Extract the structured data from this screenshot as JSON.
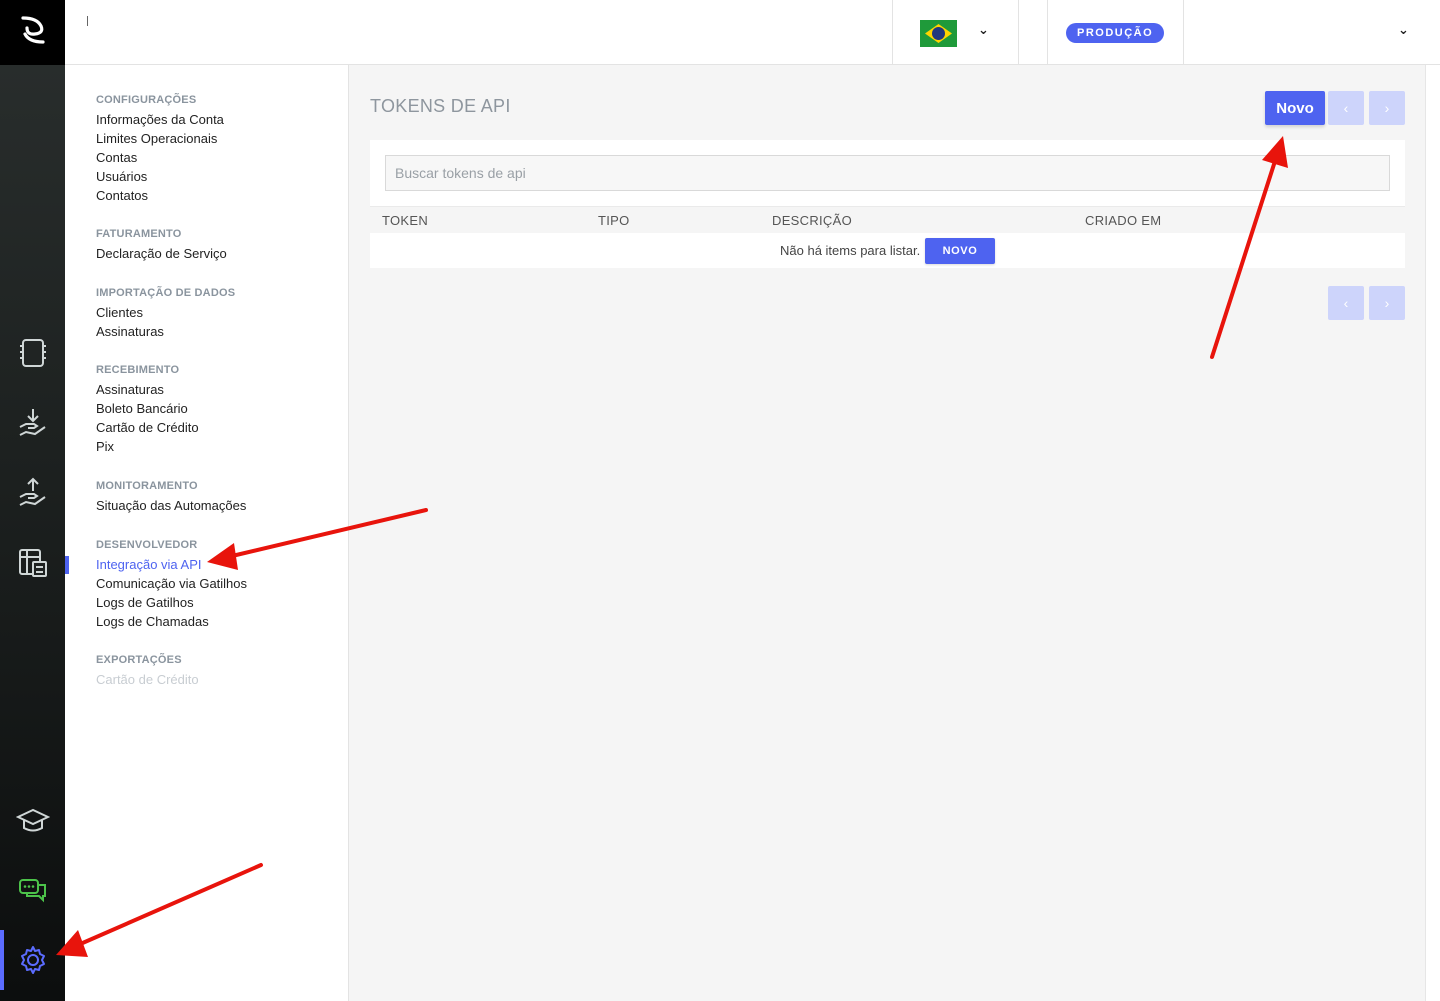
{
  "header": {
    "environment_badge": "PRODUÇÃO",
    "flag_icon": "brazil-flag-icon",
    "country_chevron": "⌄",
    "account_chevron": "⌄"
  },
  "rail": {
    "icons": [
      "app-logo-icon",
      "catalog-icon",
      "receive-money-icon",
      "send-money-icon",
      "spreadsheet-calculator-icon",
      "graduation-cap-icon",
      "chat-icon",
      "gear-icon"
    ],
    "accent_color": "#5b6cff",
    "chat_color": "#4cc34a"
  },
  "sidebar": {
    "sections": [
      {
        "title": "CONFIGURAÇÕES",
        "items": [
          "Informações da Conta",
          "Limites Operacionais",
          "Contas",
          "Usuários",
          "Contatos"
        ]
      },
      {
        "title": "FATURAMENTO",
        "items": [
          "Declaração de Serviço"
        ]
      },
      {
        "title": "IMPORTAÇÃO DE DADOS",
        "items": [
          "Clientes",
          "Assinaturas"
        ]
      },
      {
        "title": "RECEBIMENTO",
        "items": [
          "Assinaturas",
          "Boleto Bancário",
          "Cartão de Crédito",
          "Pix"
        ]
      },
      {
        "title": "MONITORAMENTO",
        "items": [
          "Situação das Automações"
        ]
      },
      {
        "title": "DESENVOLVEDOR",
        "items": [
          "Integração via API",
          "Comunicação via Gatilhos",
          "Logs de Gatilhos",
          "Logs de Chamadas"
        ]
      },
      {
        "title": "EXPORTAÇÕES",
        "items": [
          "Cartão de Crédito"
        ]
      }
    ],
    "active_item": "Integração via API"
  },
  "main": {
    "title": "TOKENS DE API",
    "new_button": "Novo",
    "prev_label": "‹",
    "next_label": "›",
    "search_placeholder": "Buscar tokens de api",
    "columns": [
      "TOKEN",
      "TIPO",
      "DESCRIÇÃO",
      "CRIADO EM"
    ],
    "empty_message": "Não há items para listar.",
    "empty_new_button": "NOVO"
  },
  "colors": {
    "primary": "#4e63f0",
    "pager_disabled": "#cdd4fb",
    "annotation_arrow": "#e8140c"
  }
}
